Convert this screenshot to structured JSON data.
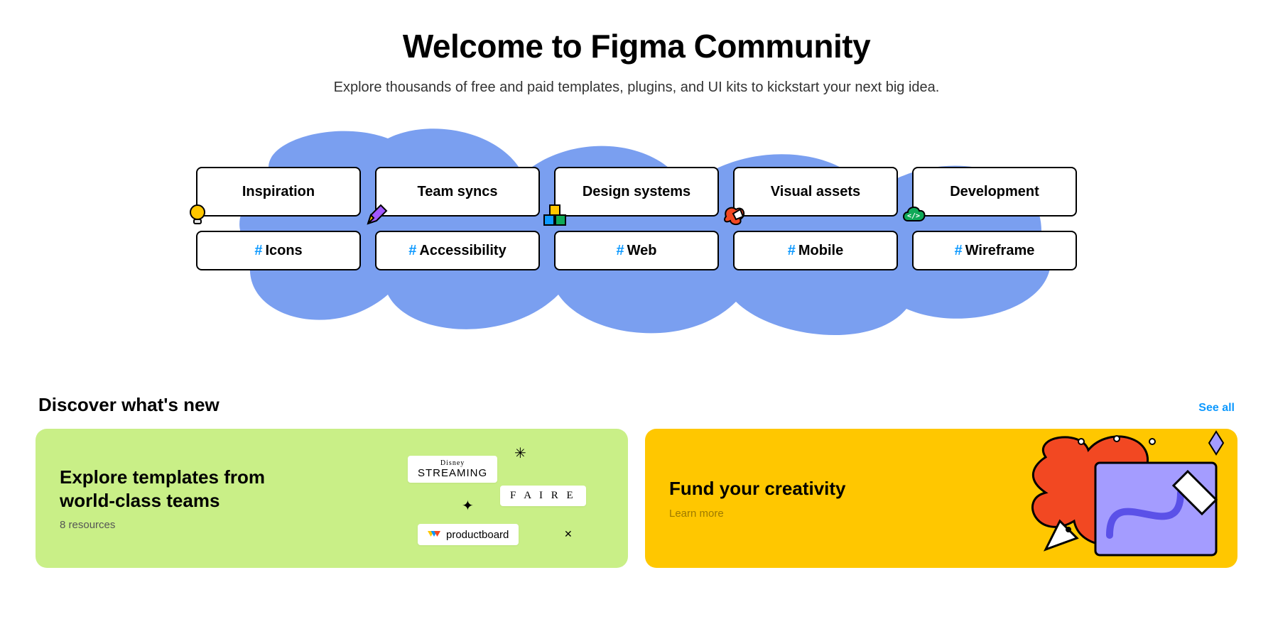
{
  "hero": {
    "title": "Welcome to Figma Community",
    "subtitle": "Explore thousands of free and paid templates, plugins, and UI kits to kickstart your next big idea."
  },
  "categories": [
    {
      "label": "Inspiration",
      "icon": "lightbulb"
    },
    {
      "label": "Team syncs",
      "icon": "pencil"
    },
    {
      "label": "Design systems",
      "icon": "blocks"
    },
    {
      "label": "Visual assets",
      "icon": "pen-blob"
    },
    {
      "label": "Development",
      "icon": "code-cloud"
    }
  ],
  "tags": [
    {
      "label": "Icons"
    },
    {
      "label": "Accessibility"
    },
    {
      "label": "Web"
    },
    {
      "label": "Mobile"
    },
    {
      "label": "Wireframe"
    }
  ],
  "hash": "#",
  "section": {
    "heading": "Discover what's new",
    "see_all": "See all"
  },
  "cards": {
    "templates": {
      "title_line1": "Explore templates from",
      "title_line2": "world-class teams",
      "sub": "8 resources",
      "logos": [
        "STREAMING",
        "F A I R E",
        "productboard"
      ],
      "logo_prefix": "Disney"
    },
    "fund": {
      "title": "Fund your creativity",
      "sub": "Learn more"
    }
  },
  "colors": {
    "accent": "#0d99ff",
    "blob": "#7a9ff0"
  }
}
